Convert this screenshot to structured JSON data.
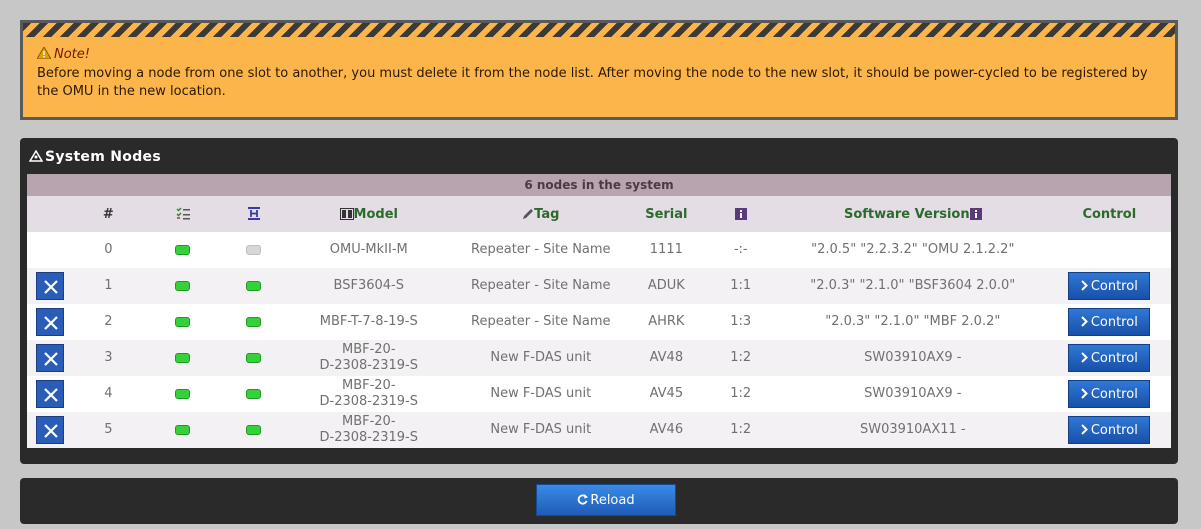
{
  "note": {
    "title": "Note!",
    "text": "Before moving a node from one slot to another, you must delete it from the node list. After moving the node to the new slot, it should be power-cycled to be registered by the OMU in the new location."
  },
  "panel": {
    "title": "System Nodes",
    "summary": "6 nodes in the system",
    "headers": {
      "index": "#",
      "model": "Model",
      "tag": "Tag",
      "serial": "Serial",
      "software": "Software Version",
      "control": "Control"
    },
    "rows": [
      {
        "index": "0",
        "model": "OMU-MkII-M",
        "tag": "Repeater - Site Name",
        "serial": "1111",
        "slot": "-:-",
        "software": "\"2.0.5\" \"2.2.3.2\" \"OMU 2.1.2.2\"",
        "status1": "green",
        "status2": "grey"
      },
      {
        "index": "1",
        "model": "BSF3604-S",
        "tag": "Repeater - Site Name",
        "serial": "ADUK",
        "slot": "1:1",
        "software": "\"2.0.3\" \"2.1.0\" \"BSF3604 2.0.0\"",
        "status1": "green",
        "status2": "green",
        "control": "Control"
      },
      {
        "index": "2",
        "model": "MBF-T-7-8-19-S",
        "tag": "Repeater - Site Name",
        "serial": "AHRK",
        "slot": "1:3",
        "software": "\"2.0.3\" \"2.1.0\" \"MBF 2.0.2\"",
        "status1": "green",
        "status2": "green",
        "control": "Control"
      },
      {
        "index": "3",
        "model_line1": "MBF-20-",
        "model_line2": "D-2308-2319-S",
        "tag": "New F-DAS unit",
        "serial": "AV48",
        "slot": "1:2",
        "software": "SW03910AX9 -",
        "status1": "green",
        "status2": "green",
        "control": "Control"
      },
      {
        "index": "4",
        "model_line1": "MBF-20-",
        "model_line2": "D-2308-2319-S",
        "tag": "New F-DAS unit",
        "serial": "AV45",
        "slot": "1:2",
        "software": "SW03910AX9 -",
        "status1": "green",
        "status2": "green",
        "control": "Control"
      },
      {
        "index": "5",
        "model_line1": "MBF-20-",
        "model_line2": "D-2308-2319-S",
        "tag": "New F-DAS unit",
        "serial": "AV46",
        "slot": "1:2",
        "software": "SW03910AX11 -",
        "status1": "green",
        "status2": "green",
        "control": "Control"
      }
    ]
  },
  "footer": {
    "reload_label": "Reload"
  },
  "colors": {
    "note_bg": "#fbb54a",
    "panel_bg": "#2a2a2a",
    "button_blue": "#1e5cb8",
    "led_green": "#35d13a"
  }
}
